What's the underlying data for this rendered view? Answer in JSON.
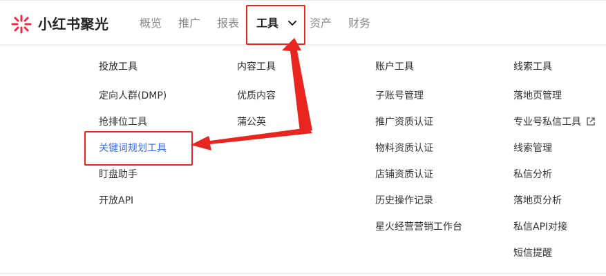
{
  "header": {
    "brand": "小红书聚光",
    "logo_icon": "starburst-logo-icon",
    "nav": [
      {
        "label": "概览",
        "active": false
      },
      {
        "label": "推广",
        "active": false
      },
      {
        "label": "报表",
        "active": false
      },
      {
        "label": "工具",
        "active": true,
        "icon": "chevron-down-icon"
      },
      {
        "label": "资产",
        "active": false
      },
      {
        "label": "财务",
        "active": false
      }
    ]
  },
  "dropdown": {
    "columns": [
      {
        "title": "投放工具",
        "items": [
          "定向人群(DMP)",
          "抢排位工具",
          "关键词规划工具",
          "盯盘助手",
          "开放API"
        ]
      },
      {
        "title": "内容工具",
        "items": [
          "优质内容",
          "蒲公英"
        ]
      },
      {
        "title": "账户工具",
        "items": [
          "子账号管理",
          "推广资质认证",
          "物料资质认证",
          "店铺资质认证",
          "历史操作记录",
          "星火经营营销工作台"
        ]
      },
      {
        "title": "线索工具",
        "items": [
          "落地页管理",
          "专业号私信工具",
          "线索管理",
          "私信分析",
          "落地页分析",
          "私信API对接",
          "短信提醒"
        ],
        "external_icon": "external-link-icon"
      }
    ]
  },
  "colors": {
    "brand_red": "#ff2442",
    "annotation_red": "#e8261f",
    "link_blue": "#3a6ee6"
  }
}
